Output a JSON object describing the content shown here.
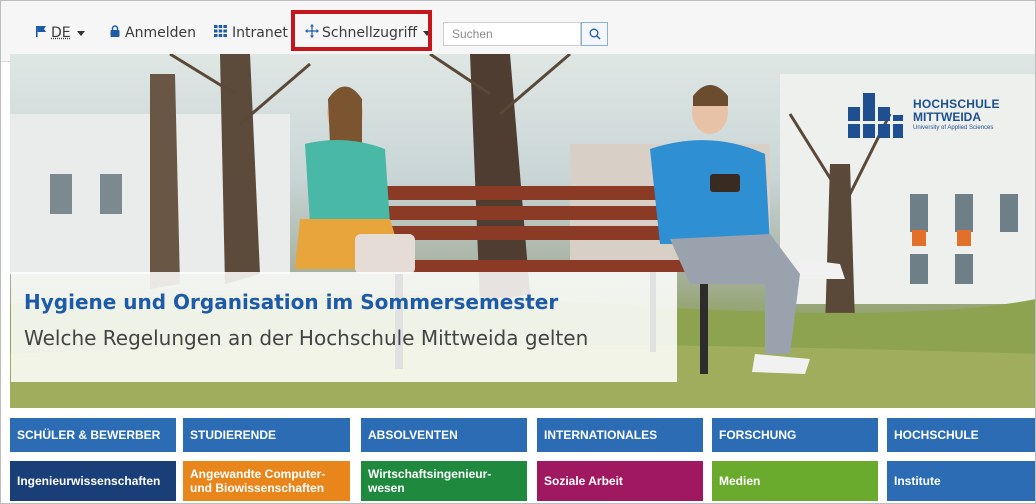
{
  "topbar": {
    "lang_label": "DE",
    "login_label": "Anmelden",
    "intranet_label": "Intranet",
    "quickaccess_label": "Schnellzugriff",
    "search_placeholder": "Suchen"
  },
  "hero": {
    "headline": "Hygiene und Organisation im Sommersemester",
    "subline": "Welche Regelungen an der Hochschule Mittweida gelten"
  },
  "logo": {
    "line1": "HOCHSCHULE",
    "line2": "MITTWEIDA",
    "tagline": "University of Applied Sciences"
  },
  "categories": [
    {
      "label": "SCHÜLER & BEWERBER",
      "color": "#2b6cb5"
    },
    {
      "label": "STUDIERENDE",
      "color": "#2b6cb5"
    },
    {
      "label": "ABSOLVENTEN",
      "color": "#2b6cb5"
    },
    {
      "label": "INTERNATIONALES",
      "color": "#2b6cb5"
    },
    {
      "label": "FORSCHUNG",
      "color": "#2b6cb5"
    },
    {
      "label": "HOCHSCHULE",
      "color": "#2b6cb5"
    }
  ],
  "faculties": [
    {
      "line1": "Ingenieurwissenschaften",
      "line2": "",
      "color": "#1a3f78"
    },
    {
      "line1": "Angewandte Computer-",
      "line2": "und Biowissenschaften",
      "color": "#e8851b"
    },
    {
      "line1": "Wirtschaftsingenieur-",
      "line2": "wesen",
      "color": "#1f8a3e"
    },
    {
      "line1": "Soziale Arbeit",
      "line2": "",
      "color": "#a0185f"
    },
    {
      "line1": "Medien",
      "line2": "",
      "color": "#6aab2e"
    },
    {
      "line1": "Institute",
      "line2": "",
      "color": "#2b6cb5"
    }
  ],
  "colors": {
    "highlight_frame": "#c4161c",
    "brand_blue": "#1d5aa8"
  }
}
